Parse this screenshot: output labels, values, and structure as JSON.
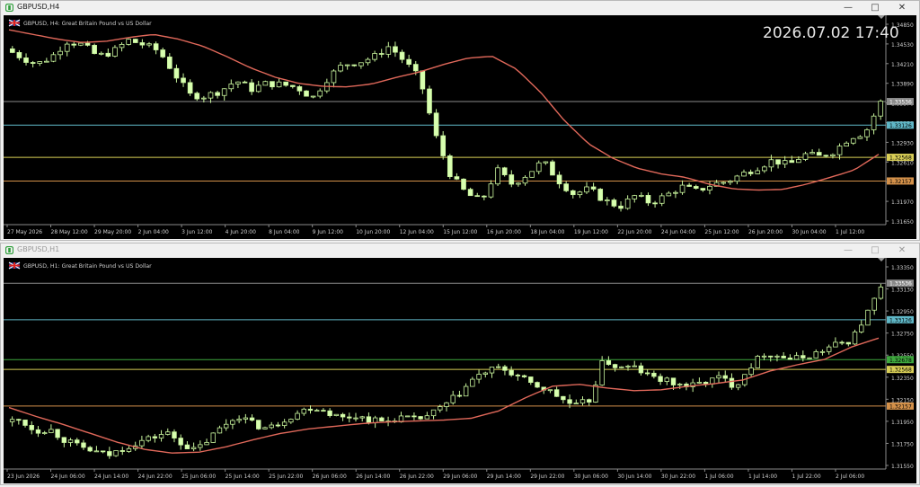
{
  "colors": {
    "background": "#000000",
    "bull_candle": "#c9f59d",
    "bear_candle": "#d8ffb0",
    "wick": "#c9f59d",
    "ma_line": "#e0685a",
    "axis_text": "#cfcfcf",
    "line_cyan": "#5fb7c7",
    "line_yellow": "#d9cf57",
    "line_orange": "#d4914a",
    "line_green": "#3ea83e",
    "line_gray": "#8a8a8a",
    "clock": "#e6e6e6"
  },
  "windows": [
    {
      "title": "GBPUSD,H4",
      "subtitle": "GBPUSD, H4:  Great Britain Pound vs US Dollar",
      "clock": "2026.07.02 17:40",
      "price_axis": {
        "labels": [
          "1.34850",
          "1.34530",
          "1.34210",
          "1.33890",
          "1.33570",
          "1.33250",
          "1.32930",
          "1.32610",
          "1.32290",
          "1.31970",
          "1.31650"
        ],
        "min": 1.314,
        "max": 1.3497
      },
      "time_axis": [
        "27 May 2026",
        "28 May 12:00",
        "29 May 20:00",
        "2 Jun 04:00",
        "3 Jun 12:00",
        "4 Jun 20:00",
        "8 Jun 04:00",
        "9 Jun 12:00",
        "10 Jun 20:00",
        "12 Jun 04:00",
        "15 Jun 12:00",
        "16 Jun 20:00",
        "18 Jun 04:00",
        "19 Jun 12:00",
        "22 Jun 20:00",
        "24 Jun 04:00",
        "25 Jun 12:00",
        "26 Jun 20:00",
        "30 Jun 04:00",
        "1 Jul 12:00"
      ],
      "price_tags": [
        {
          "text": "1.33536",
          "value": 1.33536,
          "color_key": "line_gray",
          "text_color": "#ffffff"
        },
        {
          "text": "1.33126",
          "value": 1.33126,
          "color_key": "line_cyan",
          "text_color": "#000000"
        },
        {
          "text": "1.32568",
          "value": 1.32568,
          "color_key": "line_yellow",
          "text_color": "#000000"
        },
        {
          "text": "1.32157",
          "value": 1.32157,
          "color_key": "line_orange",
          "text_color": "#000000"
        }
      ],
      "chart_data": {
        "type": "candlestick",
        "timeframe": "H4",
        "x_labels": [
          "27 May 2026",
          "28 May 12:00",
          "29 May 20:00",
          "2 Jun 04:00",
          "3 Jun 12:00",
          "4 Jun 20:00",
          "8 Jun 04:00",
          "9 Jun 12:00",
          "10 Jun 20:00",
          "12 Jun 04:00",
          "15 Jun 12:00",
          "16 Jun 20:00",
          "18 Jun 04:00",
          "19 Jun 12:00",
          "22 Jun 20:00",
          "24 Jun 04:00",
          "25 Jun 12:00",
          "26 Jun 20:00",
          "30 Jun 04:00",
          "1 Jul 12:00"
        ],
        "close_path": [
          1.3445,
          1.3431,
          1.3418,
          1.3431,
          1.3458,
          1.3452,
          1.3432,
          1.344,
          1.346,
          1.3452,
          1.3441,
          1.3402,
          1.3365,
          1.3363,
          1.3372,
          1.339,
          1.3375,
          1.3385,
          1.3383,
          1.3378,
          1.336,
          1.3395,
          1.3418,
          1.3422,
          1.3431,
          1.345,
          1.3423,
          1.3392,
          1.3295,
          1.3225,
          1.3194,
          1.318,
          1.3235,
          1.321,
          1.3228,
          1.325,
          1.3217,
          1.3193,
          1.3202,
          1.3182,
          1.3171,
          1.319,
          1.3178,
          1.319,
          1.3206,
          1.3198,
          1.321,
          1.3215,
          1.3228,
          1.324,
          1.3252,
          1.3243,
          1.3262,
          1.3258,
          1.3268,
          1.3292,
          1.33,
          1.3352
        ],
        "ma_path": [
          1.3478,
          1.347,
          1.3462,
          1.3456,
          1.3458,
          1.3465,
          1.347,
          1.3462,
          1.345,
          1.3432,
          1.3412,
          1.3396,
          1.3385,
          1.338,
          1.3379,
          1.3384,
          1.3395,
          1.3405,
          1.3418,
          1.3429,
          1.3432,
          1.341,
          1.337,
          1.332,
          1.328,
          1.3255,
          1.3238,
          1.3228,
          1.3222,
          1.321,
          1.3202,
          1.32,
          1.3201,
          1.321,
          1.3222,
          1.3235,
          1.3262
        ],
        "horizontal_lines": [
          1.33536,
          1.33126,
          1.32568,
          1.32157
        ]
      }
    },
    {
      "title": "GBPUSD,H1",
      "subtitle": "GBPUSD, H1:  Great Britain Pound vs US Dollar",
      "price_axis": {
        "labels": [
          "1.33350",
          "1.33130",
          "1.32950",
          "1.32750",
          "1.32550",
          "1.32350",
          "1.32150",
          "1.31950",
          "1.31750",
          "1.31550"
        ],
        "min": 1.3145,
        "max": 1.3378
      },
      "time_axis": [
        "23 Jun 2026",
        "24 Jun 06:00",
        "24 Jun 14:00",
        "24 Jun 22:00",
        "25 Jun 06:00",
        "25 Jun 14:00",
        "25 Jun 22:00",
        "26 Jun 06:00",
        "26 Jun 14:00",
        "26 Jun 22:00",
        "29 Jun 06:00",
        "29 Jun 14:00",
        "29 Jun 22:00",
        "30 Jun 06:00",
        "30 Jun 14:00",
        "30 Jun 22:00",
        "1 Jul 06:00",
        "1 Jul 14:00",
        "1 Jul 22:00",
        "2 Jul 06:00"
      ],
      "price_tags": [
        {
          "text": "1.33536",
          "value": 1.33536,
          "color_key": "line_gray",
          "text_color": "#ffffff"
        },
        {
          "text": "1.33126",
          "value": 1.33126,
          "color_key": "line_cyan",
          "text_color": "#000000"
        },
        {
          "text": "1.32678",
          "value": 1.32678,
          "color_key": "line_green",
          "text_color": "#000000"
        },
        {
          "text": "1.32568",
          "value": 1.32568,
          "color_key": "line_yellow",
          "text_color": "#000000"
        },
        {
          "text": "1.32157",
          "value": 1.32157,
          "color_key": "line_orange",
          "text_color": "#000000"
        }
      ],
      "chart_data": {
        "type": "candlestick",
        "timeframe": "H1",
        "x_labels": [
          "23 Jun 2026",
          "24 Jun 06:00",
          "24 Jun 14:00",
          "24 Jun 22:00",
          "25 Jun 06:00",
          "25 Jun 14:00",
          "25 Jun 22:00",
          "26 Jun 06:00",
          "26 Jun 14:00",
          "26 Jun 22:00",
          "29 Jun 06:00",
          "29 Jun 14:00",
          "29 Jun 22:00",
          "30 Jun 06:00",
          "30 Jun 14:00",
          "30 Jun 22:00",
          "1 Jul 06:00",
          "1 Jul 14:00",
          "1 Jul 22:00",
          "2 Jul 06:00"
        ],
        "close_path": [
          1.3198,
          1.32,
          1.3188,
          1.319,
          1.3178,
          1.317,
          1.3165,
          1.316,
          1.3168,
          1.3175,
          1.318,
          1.3186,
          1.3175,
          1.3165,
          1.318,
          1.3195,
          1.3205,
          1.3195,
          1.319,
          1.32,
          1.3208,
          1.3215,
          1.321,
          1.3202,
          1.3205,
          1.32,
          1.3198,
          1.3203,
          1.32,
          1.3205,
          1.3215,
          1.3228,
          1.3245,
          1.3255,
          1.3258,
          1.325,
          1.324,
          1.3235,
          1.3225,
          1.3215,
          1.3222,
          1.3268,
          1.3258,
          1.326,
          1.325,
          1.3245,
          1.324,
          1.3238,
          1.3243,
          1.3248,
          1.3238,
          1.326,
          1.3275,
          1.3272,
          1.3268,
          1.3272,
          1.3278,
          1.3285,
          1.329,
          1.3318,
          1.3348
        ],
        "ma_path": [
          1.3214,
          1.3204,
          1.3195,
          1.3185,
          1.3175,
          1.3167,
          1.3163,
          1.3164,
          1.317,
          1.3178,
          1.3185,
          1.319,
          1.3193,
          1.3196,
          1.3198,
          1.3199,
          1.32,
          1.3202,
          1.321,
          1.3225,
          1.3238,
          1.324,
          1.3236,
          1.3233,
          1.3234,
          1.3238,
          1.3241,
          1.3245,
          1.3255,
          1.3262,
          1.3268,
          1.3282,
          1.3292
        ],
        "horizontal_lines": [
          1.33536,
          1.33126,
          1.32678,
          1.32568,
          1.32157
        ]
      }
    }
  ]
}
